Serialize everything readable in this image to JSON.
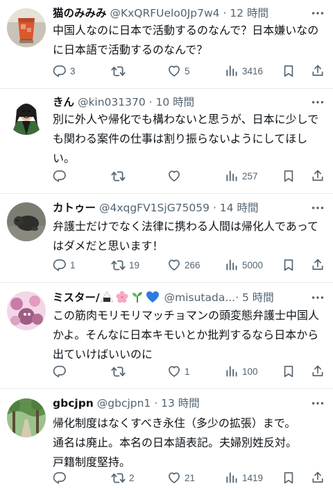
{
  "tweets": [
    {
      "name": "猫のみみみ",
      "handle": "@KxQRFUelo0Jp7w4",
      "time": "· 12 時間",
      "text": "中国人なのに日本で活動するのなんで？日本嫌いなのに日本語で活動するのなんで？",
      "replies": "3",
      "retweets": "",
      "likes": "5",
      "views": "3416"
    },
    {
      "name": "きん",
      "handle": "@kin031370",
      "time": "· 10 時間",
      "text": "別に外人や帰化でも構わないと思うが、日本に少しでも関わる案件の仕事は割り振らないようにしてほしい。",
      "replies": "",
      "retweets": "",
      "likes": "",
      "views": "257"
    },
    {
      "name": "カトゥー",
      "handle": "@4xqgFV1SjG75059",
      "time": "· 14 時間",
      "text": "弁護士だけでなく法律に携わる人間は帰化人であってはダメだと思います！",
      "replies": "1",
      "retweets": "19",
      "likes": "266",
      "views": "5000"
    },
    {
      "name": "ミスター/",
      "handle": "@misutada...",
      "time": "· 5 時間",
      "text": "この筋肉モリモリマッチョマンの頭変態弁護士中国人かよ。そんなに日本キモいとか批判するなら日本から出ていけばいいのに",
      "replies": "",
      "retweets": "",
      "likes": "1",
      "views": "100"
    },
    {
      "name": "gbcjpn",
      "handle": "@gbcjpn1",
      "time": "· 13 時間",
      "text": "帰化制度はなくすべき永住（多少の拡張）まで。\n通名は廃止。本名の日本語表記。夫婦別姓反対。\n戸籍制度堅持。",
      "replies": "",
      "retweets": "2",
      "likes": "21",
      "views": "1419"
    }
  ],
  "icons": {
    "reply": "reply-icon",
    "retweet": "retweet-icon",
    "like": "heart-icon",
    "views": "views-chart-icon",
    "bookmark": "bookmark-icon",
    "share": "share-icon",
    "more": "more-icon"
  },
  "colors": {
    "text": "#0f1419",
    "secondary": "#536471",
    "divider": "#e6e9eb"
  }
}
